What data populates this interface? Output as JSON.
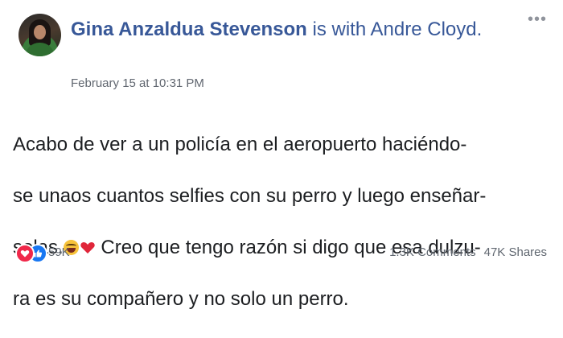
{
  "post": {
    "author": "Gina Anzaldua Stevenson",
    "with_text": " is with ",
    "tagged": "Andre Cloyd.",
    "timestamp": "February 15 at 10:31 PM",
    "more_icon": "ellipsis-icon",
    "body_lines": [
      "Acabo de ver a un policía en el aeropuerto haciéndo-",
      "se unaos cuantos selfies con su perro y luego enseñar-",
      "selas.",
      "  Creo que tengo razón si digo que esa dulzu-",
      "ra es su compañero y no solo un perro."
    ],
    "emojis": [
      "laughing-tears-emoji",
      "red-heart-emoji"
    ]
  },
  "footer": {
    "reaction_icons": [
      "love-reaction-icon",
      "like-reaction-icon"
    ],
    "reaction_count": "59K",
    "comments": "1.3K Comments",
    "shares": "47K Shares"
  },
  "colors": {
    "link_blue": "#385898",
    "meta_gray": "#616770",
    "love_red": "#f0284a",
    "like_blue": "#1877f2"
  }
}
